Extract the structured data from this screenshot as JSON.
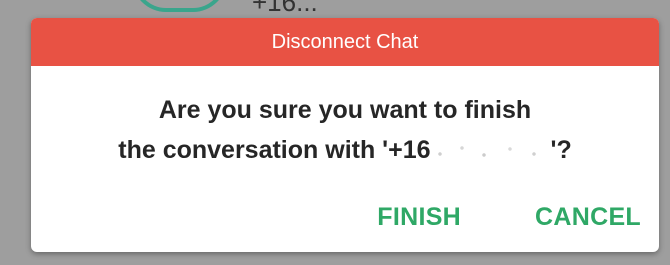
{
  "background": {
    "partial_text": "+16...",
    "accent_color": "#3aa58c"
  },
  "dialog": {
    "title": "Disconnect Chat",
    "header_color": "#e85244",
    "message_line1": "Are you sure you want to finish",
    "message_line2_prefix": "the conversation with '+16",
    "message_line2_suffix": "'?",
    "redacted_phone": true,
    "actions": {
      "finish_label": "FINISH",
      "cancel_label": "CANCEL",
      "button_color": "#2fa866"
    }
  }
}
